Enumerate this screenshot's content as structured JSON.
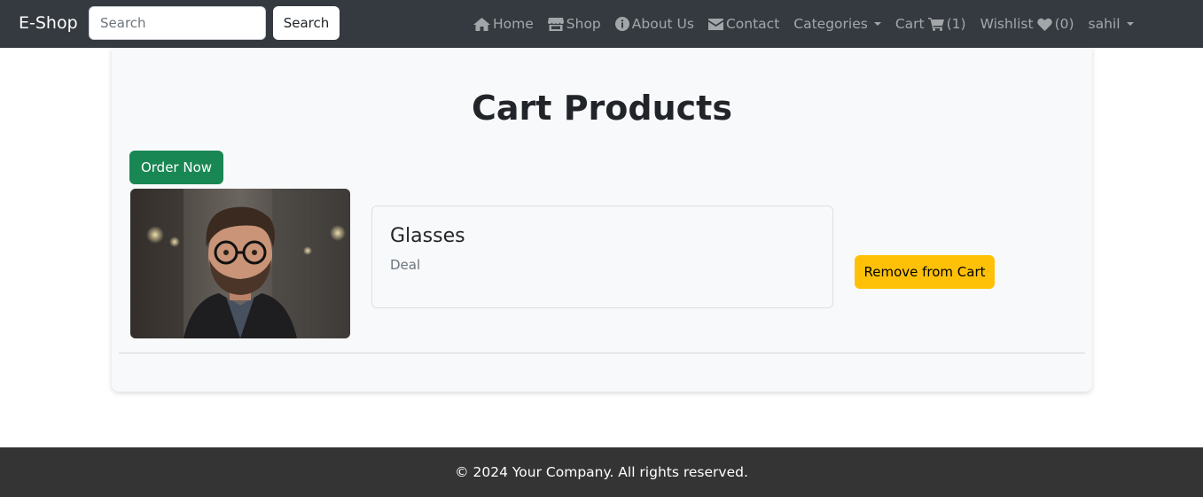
{
  "navbar": {
    "brand": "E-Shop",
    "search_placeholder": "Search",
    "search_button": "Search",
    "links": {
      "home": {
        "label": "Home",
        "icon": "home-icon"
      },
      "shop": {
        "label": "Shop",
        "icon": "store-icon"
      },
      "about": {
        "label": "About Us",
        "icon": "info-icon"
      },
      "contact": {
        "label": "Contact",
        "icon": "envelope-icon"
      },
      "categories": {
        "label": "Categories",
        "icon": "caret-down-icon"
      },
      "cart": {
        "label": "Cart",
        "count": "(1)",
        "icon": "cart-icon"
      },
      "wishlist": {
        "label": "Wishlist",
        "count": "(0)",
        "icon": "heart-icon"
      },
      "user": {
        "label": "sahil",
        "icon": "caret-down-icon"
      }
    }
  },
  "main": {
    "title": "Cart Products",
    "order_button": "Order Now",
    "items": [
      {
        "name": "Glasses",
        "description": "Deal",
        "remove_label": "Remove from Cart"
      }
    ]
  },
  "footer": {
    "text": "© 2024 Your Company. All rights reserved."
  },
  "colors": {
    "navbar_bg": "#343a40",
    "order_button": "#198754",
    "remove_button": "#ffc107",
    "footer_bg": "#343434"
  }
}
